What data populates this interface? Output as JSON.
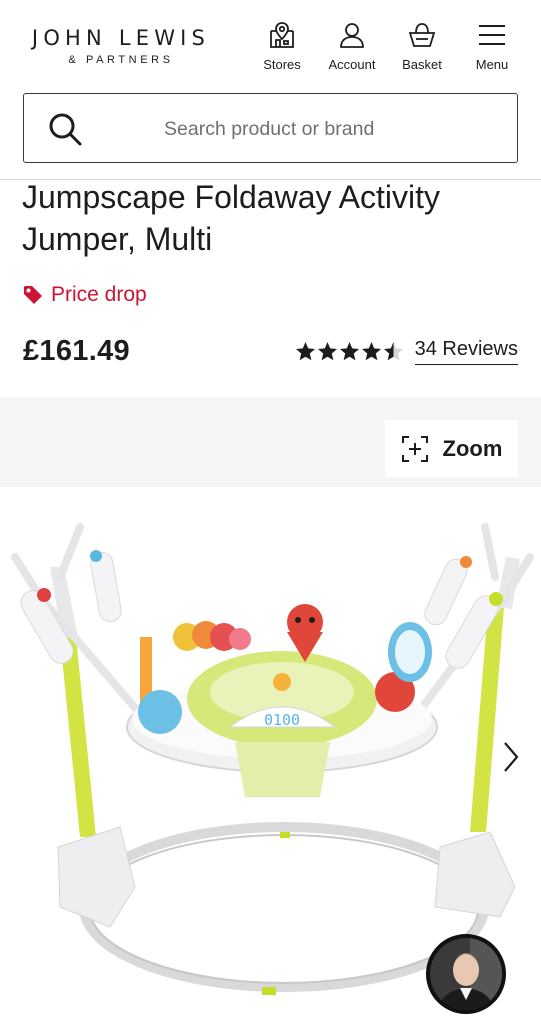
{
  "header": {
    "logo_main": "JOHN LEWIS",
    "logo_sub": "& PARTNERS",
    "nav": [
      {
        "label": "Stores",
        "icon": "stores-icon"
      },
      {
        "label": "Account",
        "icon": "account-icon"
      },
      {
        "label": "Basket",
        "icon": "basket-icon"
      },
      {
        "label": "Menu",
        "icon": "menu-icon"
      }
    ]
  },
  "search": {
    "placeholder": "Search product or brand",
    "value": ""
  },
  "product": {
    "title": "Jumpscape Foldaway Activity Jumper, Multi",
    "price_drop_label": "Price drop",
    "price": "£161.49",
    "rating": 4.5,
    "rating_max": 5,
    "reviews_label": "34 Reviews"
  },
  "gallery": {
    "zoom_label": "Zoom"
  },
  "colors": {
    "accent_red": "#cc1531",
    "text": "#1d1d1b",
    "gallery_bg": "#f5f5f5",
    "frame_green": "#c6dd2a"
  }
}
